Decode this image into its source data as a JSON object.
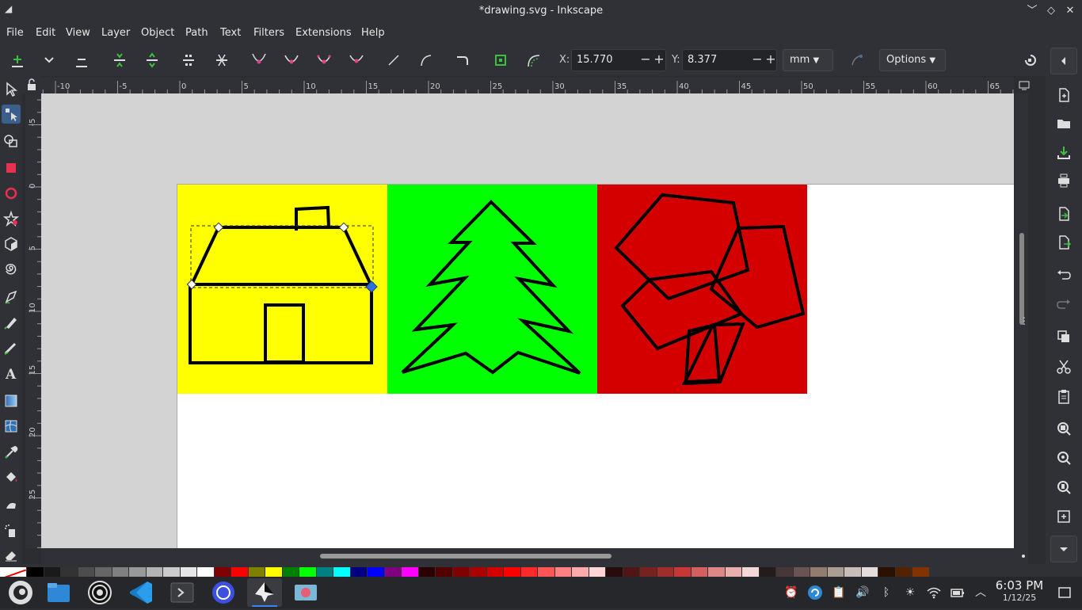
{
  "window": {
    "title": "*drawing.svg - Inkscape",
    "app_glyph": "◢"
  },
  "menu": [
    "File",
    "Edit",
    "View",
    "Layer",
    "Object",
    "Path",
    "Text",
    "Filters",
    "Extensions",
    "Help"
  ],
  "toolbar": {
    "x_label": "X:",
    "x_value": "15.770",
    "y_label": "Y:",
    "y_value": "8.377",
    "units": "mm",
    "options_label": "Options"
  },
  "ruler": {
    "h_labels": [
      "-10",
      "-5",
      "0",
      "5",
      "10",
      "15",
      "20",
      "25",
      "30",
      "35",
      "40",
      "45",
      "50",
      "55",
      "60",
      "65"
    ],
    "v_labels": [
      "-5",
      "0",
      "5",
      "10",
      "15",
      "20",
      "25"
    ]
  },
  "canvas": {
    "panels": [
      {
        "name": "house",
        "color": "#ffff00"
      },
      {
        "name": "tree",
        "color": "#00ff00"
      },
      {
        "name": "shapes",
        "color": "#d40000"
      }
    ]
  },
  "palette_colors": [
    "#000000",
    "#1a1a1a",
    "#333333",
    "#4d4d4d",
    "#666666",
    "#808080",
    "#999999",
    "#b3b3b3",
    "#cccccc",
    "#e6e6e6",
    "#ffffff",
    "#800000",
    "#ff0000",
    "#808000",
    "#ffff00",
    "#008000",
    "#00ff00",
    "#008080",
    "#00ffff",
    "#000080",
    "#0000ff",
    "#800080",
    "#ff00ff",
    "#2b0000",
    "#550000",
    "#800000",
    "#aa0000",
    "#d40000",
    "#ff0000",
    "#ff2a2a",
    "#ff5555",
    "#ff8080",
    "#ffaaaa",
    "#ffd5d5",
    "#280b0b",
    "#501616",
    "#782121",
    "#a02c2c",
    "#c83737",
    "#d35f5f",
    "#de8787",
    "#e9afaf",
    "#f4d7d7",
    "#241c1c",
    "#483737",
    "#6c5353",
    "#917c6f",
    "#ac9d93",
    "#c8beb7",
    "#e3dedb",
    "#2b1100",
    "#552200",
    "#803300"
  ],
  "taskbar": {
    "time": "6:03 PM",
    "date": "1/12/25"
  }
}
